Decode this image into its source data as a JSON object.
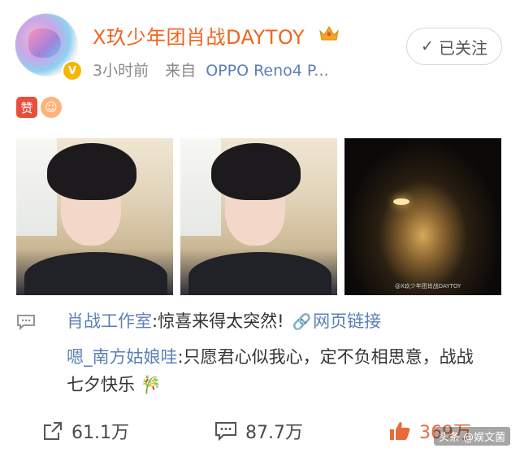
{
  "header": {
    "username": "X玖少年团肖战DAYTOY",
    "time": "3小时前",
    "from_label": "来自",
    "source": "OPPO Reno4 P...",
    "follow_label": "已关注"
  },
  "post": {
    "emojis": [
      "赞",
      "face"
    ],
    "photos": [
      {
        "type": "selfie"
      },
      {
        "type": "selfie"
      },
      {
        "type": "night-sky",
        "watermark": "@X玖少年团肖战DAYTOY"
      }
    ]
  },
  "comments": {
    "line1": {
      "author": "肖战工作室",
      "text": ":惊喜来得太突然!",
      "link": "网页链接"
    },
    "line2": {
      "author": "嗯_南方姑娘哇",
      "text": ":只愿君心似我心，定不负相思意，战战"
    },
    "line3": {
      "text": "七夕快乐"
    }
  },
  "actions": {
    "share_count": "61.1万",
    "comment_count": "87.7万",
    "like_count": "369万"
  },
  "source_watermark": "头条 @娱文菌",
  "colors": {
    "accent": "#f0641e",
    "link": "#5b7fb5",
    "like": "#e86b3a",
    "verify": "#f7b500"
  }
}
